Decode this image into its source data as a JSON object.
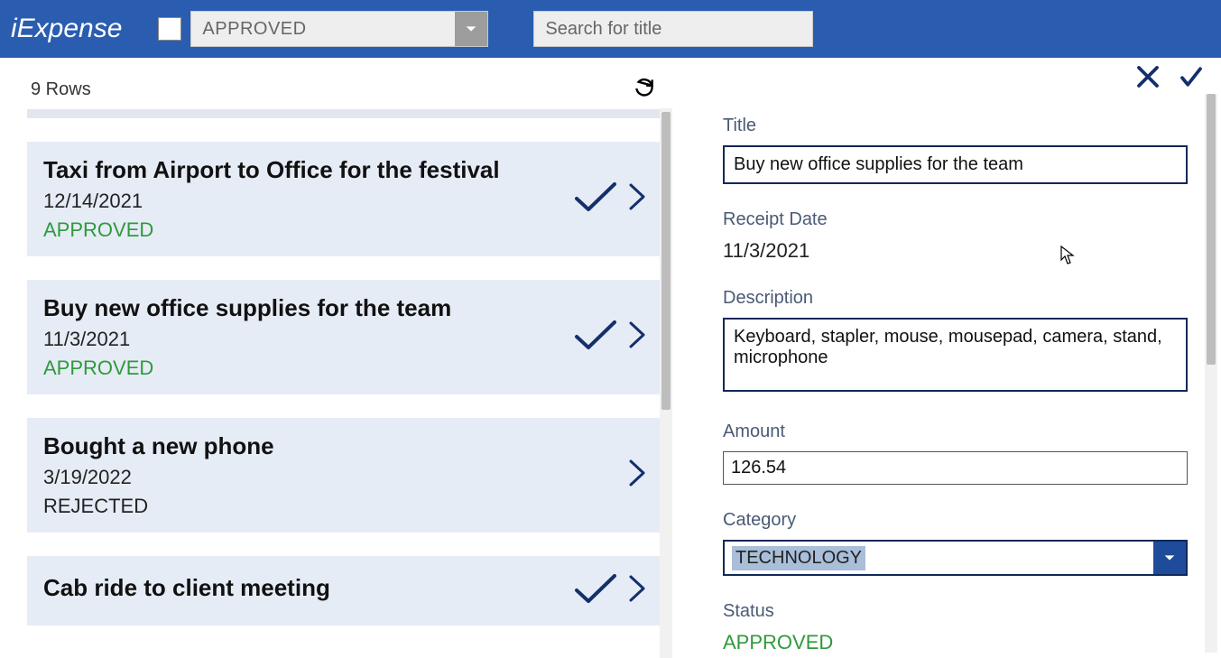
{
  "app": {
    "title": "iExpense"
  },
  "filter": {
    "value": "APPROVED"
  },
  "search": {
    "placeholder": "Search for title"
  },
  "list": {
    "rowcount": "9 Rows",
    "items": [
      {
        "title": "Taxi from Airport to Office for the festival",
        "date": "12/14/2021",
        "status": "APPROVED",
        "approved": true
      },
      {
        "title": "Buy new office supplies for the team",
        "date": "11/3/2021",
        "status": "APPROVED",
        "approved": true
      },
      {
        "title": "Bought a new phone",
        "date": "3/19/2022",
        "status": "REJECTED",
        "approved": false
      },
      {
        "title": "Cab ride to client meeting",
        "date": "",
        "status": "",
        "approved": true
      }
    ]
  },
  "detail": {
    "labels": {
      "title": "Title",
      "receipt_date": "Receipt Date",
      "description": "Description",
      "amount": "Amount",
      "category": "Category",
      "status": "Status"
    },
    "title": "Buy new office supplies for the team",
    "receipt_date": "11/3/2021",
    "description": "Keyboard, stapler, mouse, mousepad, camera, stand, microphone",
    "amount": "126.54",
    "category": "TECHNOLOGY",
    "status": "APPROVED"
  }
}
